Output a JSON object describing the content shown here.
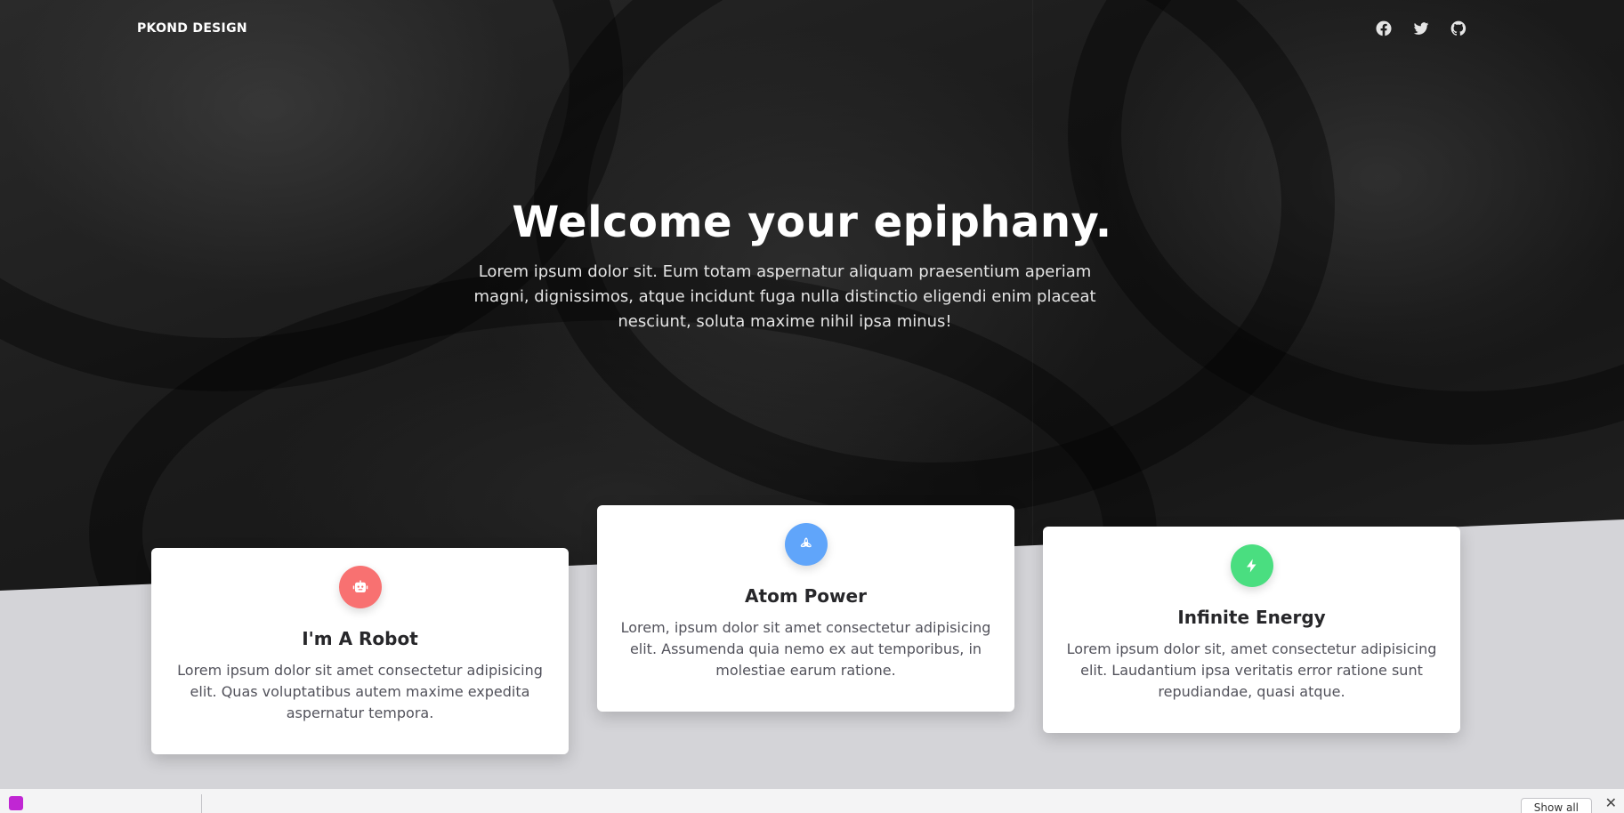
{
  "nav": {
    "brand": "PKOND DESIGN",
    "social": [
      {
        "icon": "facebook-icon"
      },
      {
        "icon": "twitter-icon"
      },
      {
        "icon": "github-icon"
      }
    ]
  },
  "hero": {
    "title": "Welcome your epiphany.",
    "lead": "Lorem ipsum dolor sit. Eum totam aspernatur aliquam praesentium aperiam magni, dignissimos, atque incidunt fuga nulla distinctio eligendi enim placeat nesciunt, soluta maxime nihil ipsa minus!"
  },
  "cards": [
    {
      "icon": "robot-icon",
      "color": "#f87171",
      "title": "I'm A Robot",
      "text": "Lorem ipsum dolor sit amet consectetur adipisicing elit. Quas voluptatibus autem maxime expedita aspernatur tempora."
    },
    {
      "icon": "atom-icon",
      "color": "#60a5fa",
      "title": "Atom Power",
      "text": "Lorem, ipsum dolor sit amet consectetur adipisicing elit. Assumenda quia nemo ex aut temporibus, in molestiae earum ratione."
    },
    {
      "icon": "bolt-icon",
      "color": "#4ade80",
      "title": "Infinite Energy",
      "text": "Lorem ipsum dolor sit, amet consectetur adipisicing elit. Laudantium ipsa veritatis error ratione sunt repudiandae, quasi atque."
    }
  ],
  "download_bar": {
    "file_label": "",
    "show_all": "Show all"
  }
}
